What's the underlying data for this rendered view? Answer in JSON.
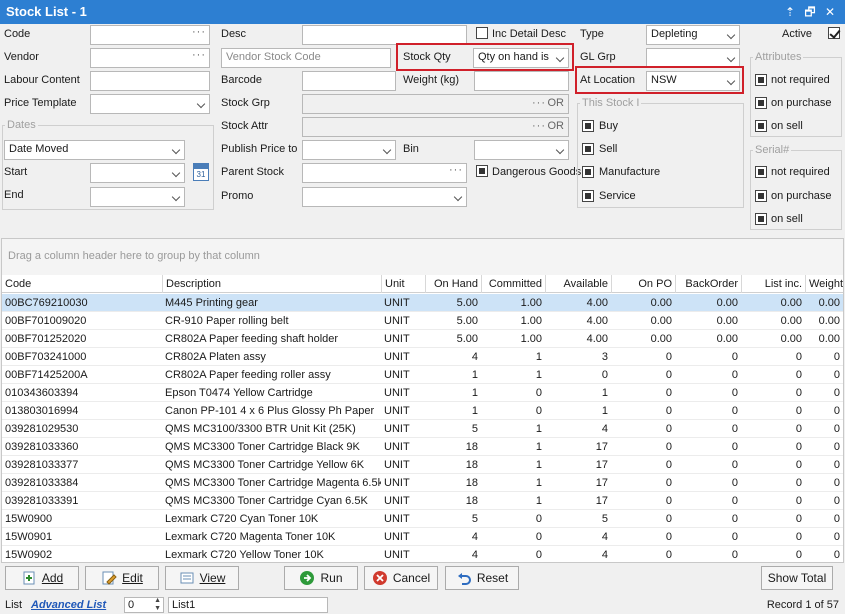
{
  "window": {
    "title": "Stock List - 1",
    "pin": "⇡",
    "restore": "🗗",
    "close": "✕"
  },
  "filters": {
    "code_label": "Code",
    "code_value": "",
    "vendor_label": "Vendor",
    "vendor_value": "",
    "labour_label": "Labour Content",
    "labour_value": "",
    "price_template_label": "Price Template",
    "price_template_value": "",
    "desc_label": "Desc",
    "desc_value": "",
    "inc_detail_label": "Inc Detail Desc",
    "vendor_stock_code_placeholder": "Vendor Stock Code",
    "stock_qty_label": "Stock Qty",
    "stock_qty_value": "Qty on hand is",
    "barcode_label": "Barcode",
    "barcode_value": "",
    "weight_label": "Weight (kg)",
    "weight_value": "",
    "stock_grp_label": "Stock Grp",
    "stock_attr_label": "Stock Attr",
    "or_text": "OR",
    "publish_price_label": "Publish Price to",
    "publish_price_value": "",
    "bin_label": "Bin",
    "bin_value": "",
    "parent_stock_label": "Parent Stock",
    "parent_stock_value": "",
    "dangerous_goods_label": "Dangerous Goods",
    "promo_label": "Promo",
    "promo_value": "",
    "type_label": "Type",
    "type_value": "Depleting",
    "active_label": "Active",
    "gl_grp_label": "GL Grp",
    "gl_grp_value": "",
    "at_location_label": "At Location",
    "at_location_value": "NSW",
    "dates_title": "Dates",
    "date_field_value": "Date Moved",
    "start_label": "Start",
    "start_value": "",
    "end_label": "End",
    "end_value": "",
    "calendar_day": "31",
    "this_stock_title": "This Stock I",
    "this_stock_items": [
      "Buy",
      "Sell",
      "Manufacture",
      "Service"
    ],
    "attributes_title": "Attributes",
    "attributes_items": [
      "not required",
      "on purchase",
      "on sell"
    ],
    "serial_title": "Serial#",
    "serial_items": [
      "not required",
      "on purchase",
      "on sell"
    ]
  },
  "grid": {
    "group_hint": "Drag a column header here to group by that column",
    "columns": [
      "Code",
      "Description",
      "Unit",
      "On Hand",
      "Committed",
      "Available",
      "On PO",
      "BackOrder",
      "List inc.",
      "Weight"
    ],
    "rows": [
      [
        "00BC769210030",
        "M445 Printing gear",
        "UNIT",
        "5.00",
        "1.00",
        "4.00",
        "0.00",
        "0.00",
        "0.00",
        "0.00"
      ],
      [
        "00BF701009020",
        "CR-910 Paper rolling belt",
        "UNIT",
        "5.00",
        "1.00",
        "4.00",
        "0.00",
        "0.00",
        "0.00",
        "0.00"
      ],
      [
        "00BF701252020",
        "CR802A Paper feeding shaft holder",
        "UNIT",
        "5.00",
        "1.00",
        "4.00",
        "0.00",
        "0.00",
        "0.00",
        "0.00"
      ],
      [
        "00BF703241000",
        "CR802A Platen assy",
        "UNIT",
        "4",
        "1",
        "3",
        "0",
        "0",
        "0",
        "0"
      ],
      [
        "00BF71425200A",
        "CR802A Paper feeding roller assy",
        "UNIT",
        "1",
        "1",
        "0",
        "0",
        "0",
        "0",
        "0"
      ],
      [
        "010343603394",
        "Epson T0474 Yellow Cartridge",
        "UNIT",
        "1",
        "0",
        "1",
        "0",
        "0",
        "0",
        "0"
      ],
      [
        "013803016994",
        "Canon PP-101  4 x 6 Plus Glossy Ph Paper",
        "UNIT",
        "1",
        "0",
        "1",
        "0",
        "0",
        "0",
        "0"
      ],
      [
        "039281029530",
        "QMS MC3100/3300 BTR Unit Kit (25K)",
        "UNIT",
        "5",
        "1",
        "4",
        "0",
        "0",
        "0",
        "0"
      ],
      [
        "039281033360",
        "QMS MC3300 Toner Cartridge Black 9K",
        "UNIT",
        "18",
        "1",
        "17",
        "0",
        "0",
        "0",
        "0"
      ],
      [
        "039281033377",
        "QMS MC3300 Toner Cartridge Yellow 6K",
        "UNIT",
        "18",
        "1",
        "17",
        "0",
        "0",
        "0",
        "0"
      ],
      [
        "039281033384",
        "QMS MC3300 Toner Cartridge Magenta 6.5k",
        "UNIT",
        "18",
        "1",
        "17",
        "0",
        "0",
        "0",
        "0"
      ],
      [
        "039281033391",
        "QMS MC3300 Toner Cartridge Cyan 6.5K",
        "UNIT",
        "18",
        "1",
        "17",
        "0",
        "0",
        "0",
        "0"
      ],
      [
        "15W0900",
        "Lexmark C720 Cyan Toner 10K",
        "UNIT",
        "5",
        "0",
        "5",
        "0",
        "0",
        "0",
        "0"
      ],
      [
        "15W0901",
        "Lexmark C720 Magenta Toner 10K",
        "UNIT",
        "4",
        "0",
        "4",
        "0",
        "0",
        "0",
        "0"
      ],
      [
        "15W0902",
        "Lexmark C720 Yellow Toner 10K",
        "UNIT",
        "4",
        "0",
        "4",
        "0",
        "0",
        "0",
        "0"
      ]
    ],
    "selected_row": 0
  },
  "buttons": {
    "add": "Add",
    "edit": "Edit",
    "view": "View",
    "run": "Run",
    "cancel": "Cancel",
    "reset": "Reset",
    "show_total": "Show Total"
  },
  "statusbar": {
    "list_label": "List",
    "advanced_list": "Advanced List",
    "list_index": "0",
    "list_name": "List1",
    "record_text": "Record 1 of 57"
  },
  "colors": {
    "title_bar": "#2d7fd2",
    "highlight_box": "#d0202a",
    "selected_row": "#cde3f7"
  }
}
